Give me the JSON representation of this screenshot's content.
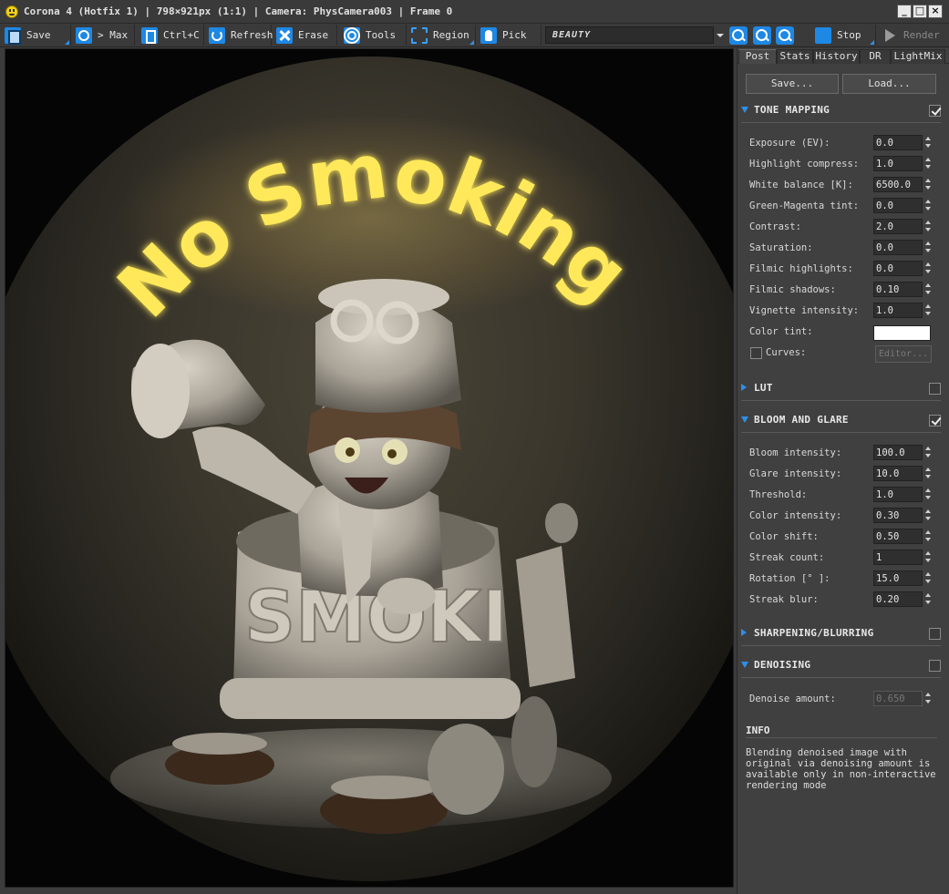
{
  "window": {
    "title": "Corona 4 (Hotfix 1) | 798×921px (1:1) | Camera: PhysCamera003 | Frame 0",
    "min_glyph": "_",
    "max_glyph": "□",
    "close_glyph": "×"
  },
  "toolbar": {
    "save": "Save",
    "max": "> Max",
    "copy": "Ctrl+C",
    "refresh": "Refresh",
    "erase": "Erase",
    "tools": "Tools",
    "region": "Region",
    "pick": "Pick",
    "pass": "BEAUTY",
    "stop": "Stop",
    "render": "Render"
  },
  "viewport": {
    "sign_text": "No Smoking",
    "barrel_text": "SMOKI"
  },
  "colors": {
    "accent": "#1e88e5",
    "sign_yellow": "#ffe95a",
    "panel_bg": "#404040"
  },
  "panel": {
    "tabs": [
      "Post",
      "Stats",
      "History",
      "DR",
      "LightMix"
    ],
    "active_tab": "Post",
    "save_button": "Save...",
    "load_button": "Load...",
    "tone_mapping": {
      "title": "TONE MAPPING",
      "enabled": true,
      "rows": [
        {
          "label": "Exposure (EV):",
          "value": "0.0"
        },
        {
          "label": "Highlight compress:",
          "value": "1.0"
        },
        {
          "label": "White balance [K]:",
          "value": "6500.0"
        },
        {
          "label": "Green-Magenta tint:",
          "value": "0.0"
        },
        {
          "label": "Contrast:",
          "value": "2.0"
        },
        {
          "label": "Saturation:",
          "value": "0.0"
        },
        {
          "label": "Filmic highlights:",
          "value": "0.0"
        },
        {
          "label": "Filmic shadows:",
          "value": "0.10"
        },
        {
          "label": "Vignette intensity:",
          "value": "1.0"
        }
      ],
      "color_tint_label": "Color tint:",
      "color_tint_value": "#ffffff",
      "curves_label": "Curves:",
      "editor_button": "Editor..."
    },
    "lut": {
      "title": "LUT",
      "enabled": false
    },
    "bloom": {
      "title": "BLOOM AND GLARE",
      "enabled": true,
      "rows": [
        {
          "label": "Bloom intensity:",
          "value": "100.0"
        },
        {
          "label": "Glare intensity:",
          "value": "10.0"
        },
        {
          "label": "Threshold:",
          "value": "1.0"
        },
        {
          "label": "Color intensity:",
          "value": "0.30"
        },
        {
          "label": "Color shift:",
          "value": "0.50"
        },
        {
          "label": "Streak count:",
          "value": "1"
        },
        {
          "label": "Rotation [° ]:",
          "value": "15.0"
        },
        {
          "label": "Streak blur:",
          "value": "0.20"
        }
      ]
    },
    "sharpening": {
      "title": "SHARPENING/BLURRING",
      "enabled": false
    },
    "denoising": {
      "title": "DENOISING",
      "enabled": false,
      "rows": [
        {
          "label": "Denoise amount:",
          "value": "0.650"
        }
      ]
    },
    "info": {
      "title": "INFO",
      "text": "Blending denoised image with original via denoising amount is available only in non-interactive rendering mode"
    }
  }
}
